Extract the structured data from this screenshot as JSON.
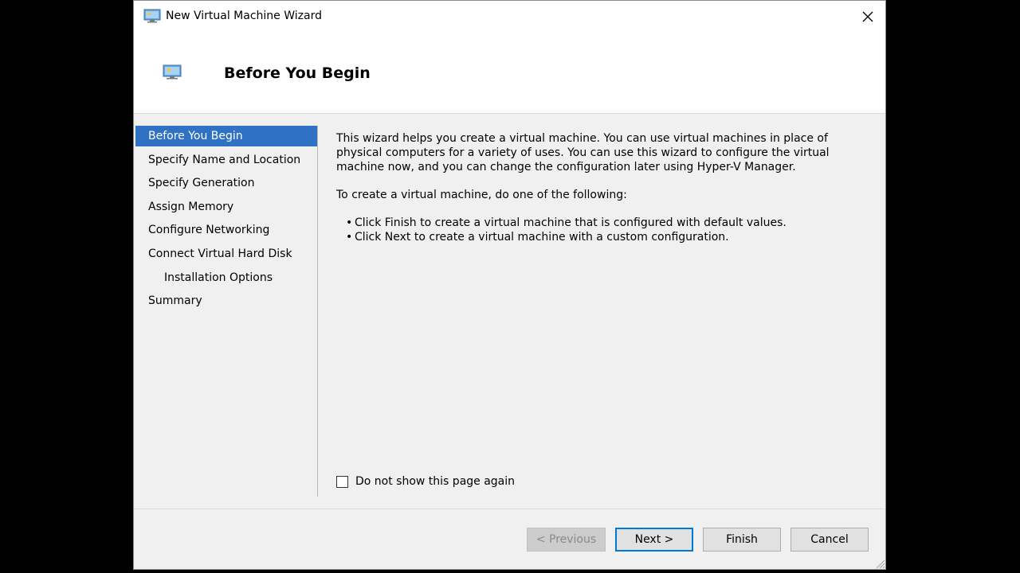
{
  "window": {
    "title": "New Virtual Machine Wizard",
    "icon": "virtual-machine-icon"
  },
  "header": {
    "title": "Before You Begin",
    "icon": "virtual-machine-icon"
  },
  "nav": {
    "items": [
      {
        "label": "Before You Begin",
        "active": true
      },
      {
        "label": "Specify Name and Location"
      },
      {
        "label": "Specify Generation"
      },
      {
        "label": "Assign Memory"
      },
      {
        "label": "Configure Networking"
      },
      {
        "label": "Connect Virtual Hard Disk"
      },
      {
        "label": "Installation Options",
        "sub": true
      },
      {
        "label": "Summary"
      }
    ]
  },
  "content": {
    "intro": "This wizard helps you create a virtual machine. You can use virtual machines in place of physical computers for a variety of uses. You can use this wizard to configure the virtual machine now, and you can change the configuration later using Hyper-V Manager.",
    "instruction": "To create a virtual machine, do one of the following:",
    "bullets": [
      "Click Finish to create a virtual machine that is configured with default values.",
      "Click Next to create a virtual machine with a custom configuration."
    ],
    "checkbox_label": "Do not show this page again",
    "checkbox_checked": false
  },
  "buttons": {
    "previous": "< Previous",
    "next": "Next >",
    "finish": "Finish",
    "cancel": "Cancel"
  },
  "colors": {
    "accent": "#0078d7",
    "selection": "#2f72c4"
  }
}
